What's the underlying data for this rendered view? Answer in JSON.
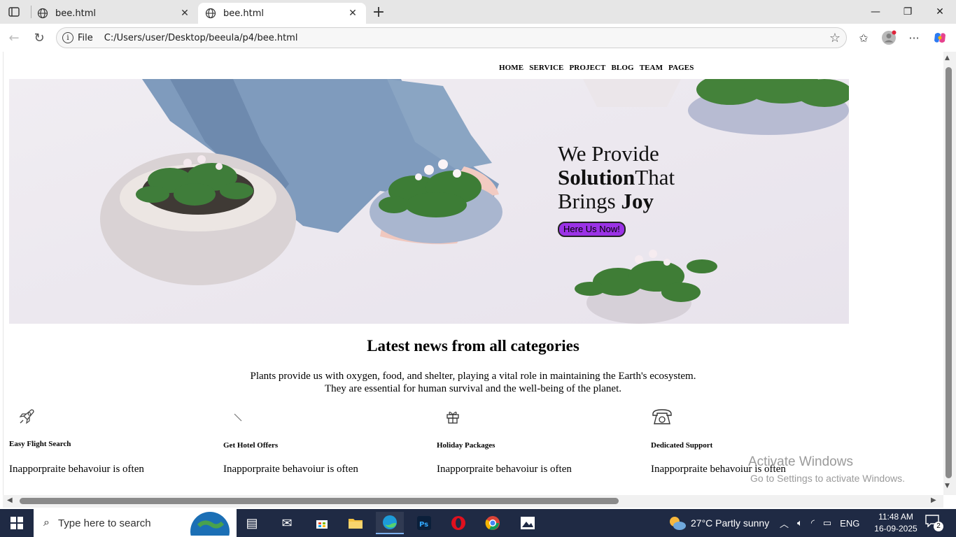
{
  "browser": {
    "tabs": [
      {
        "title": "bee.html",
        "active": false
      },
      {
        "title": "bee.html",
        "active": true
      }
    ],
    "address": {
      "scheme_label": "File",
      "url": "C:/Users/user/Desktop/beeula/p4/bee.html"
    }
  },
  "page": {
    "nav": [
      "HOME",
      "SERVICE",
      "PROJECT",
      "BLOG",
      "TEAM",
      "PAGES"
    ],
    "hero": {
      "line1": "We Provide",
      "line2_bold": "Solution",
      "line2_rest": "That",
      "line3_start": "Brings ",
      "line3_bold": "Joy",
      "button_label": "Here Us Now!",
      "button_color": "#9b32e6"
    },
    "news": {
      "title": "Latest news from all categories",
      "desc_line1": "Plants provide us with oxygen, food, and shelter, playing a vital role in maintaining the Earth's ecosystem.",
      "desc_line2": "They are essential for human survival and the well-being of the planet."
    },
    "features": [
      {
        "icon": "rocket-icon",
        "title": "Easy Flight Search",
        "body": "Inapporpraite behavoiur is often"
      },
      {
        "icon": "broken-image-icon",
        "title": "Get Hotel Offers",
        "body": "Inapporpraite behavoiur is often"
      },
      {
        "icon": "gift-icon",
        "title": "Holiday Packages",
        "body": "Inapporpraite behavoiur is often"
      },
      {
        "icon": "telephone-icon",
        "title": "Dedicated Support",
        "body": "Inapporpraite behavoiur is often"
      }
    ]
  },
  "watermark": {
    "line1": "Activate Windows",
    "line2": "Go to Settings to activate Windows."
  },
  "taskbar": {
    "search_placeholder": "Type here to search",
    "weather": "27°C  Partly sunny",
    "language": "ENG",
    "time": "11:48 AM",
    "date": "16-09-2025",
    "notification_count": "2"
  }
}
